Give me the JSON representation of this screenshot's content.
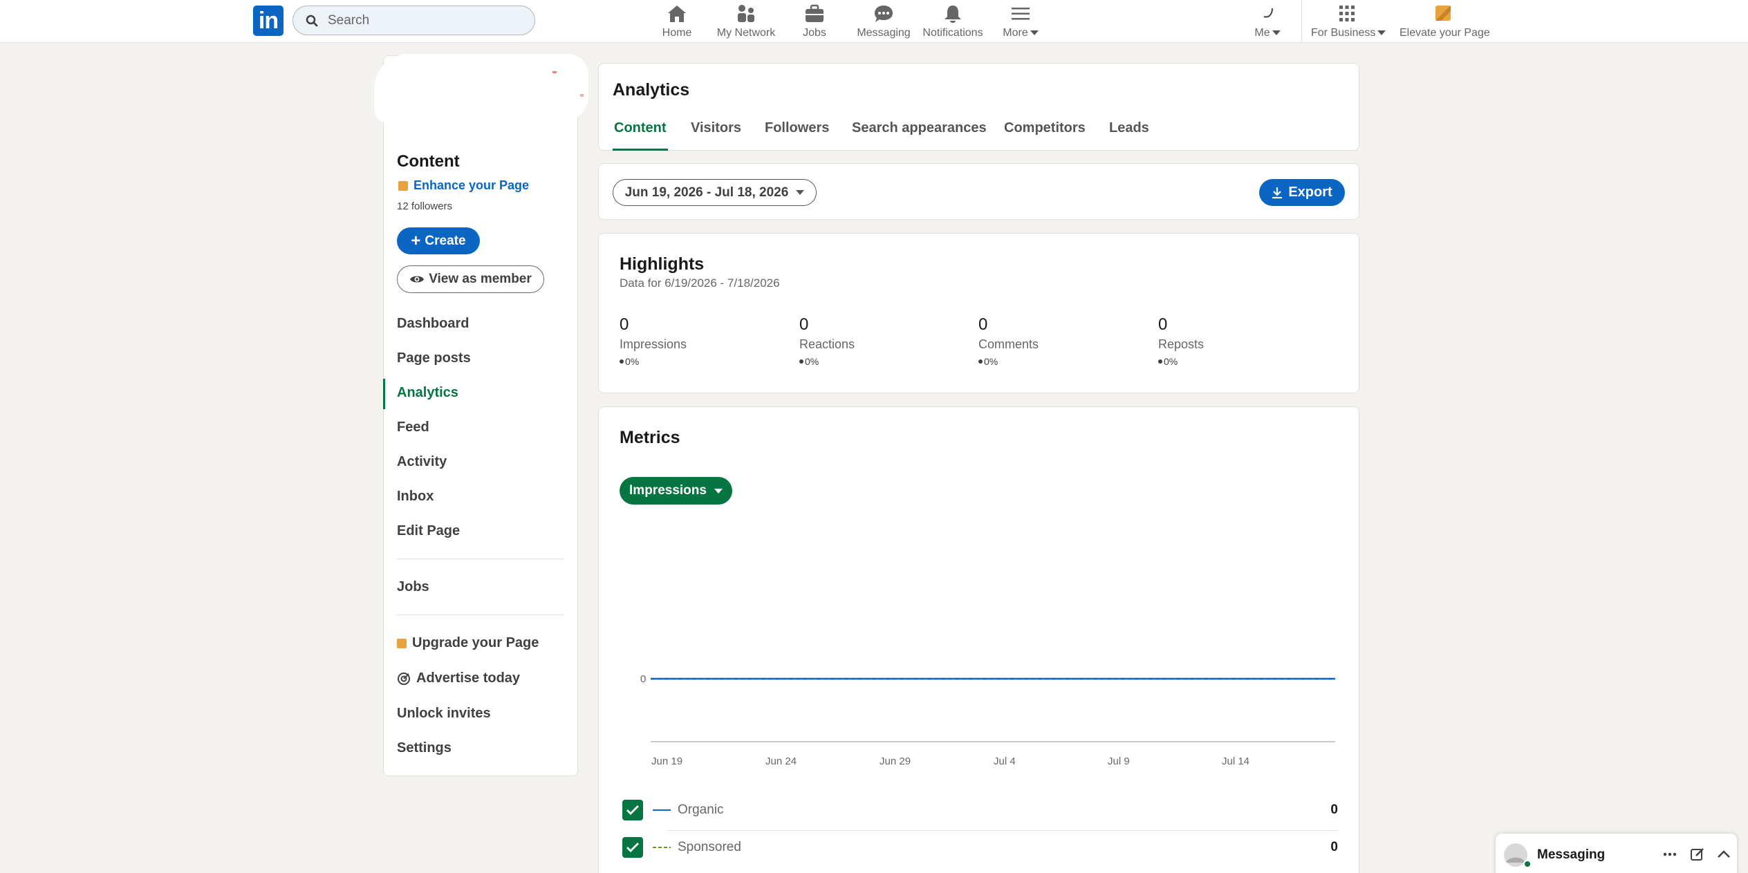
{
  "nav": {
    "logo": "in",
    "search_placeholder": "Search",
    "items": [
      {
        "label": "Home",
        "icon": "home-icon"
      },
      {
        "label": "My Network",
        "icon": "network-icon"
      },
      {
        "label": "Jobs",
        "icon": "briefcase-icon"
      },
      {
        "label": "Messaging",
        "icon": "messaging-icon"
      },
      {
        "label": "Notifications",
        "icon": "bell-icon"
      },
      {
        "label": "More",
        "icon": "menu-icon"
      }
    ],
    "me_label": "Me",
    "business_label": "For Business",
    "elevate_label": "Elevate your Page"
  },
  "sidebar": {
    "page_name": "Content",
    "enhance_label": "Enhance your Page",
    "followers": "12 followers",
    "create_label": "Create",
    "view_label": "View as member",
    "items": [
      "Dashboard",
      "Page posts",
      "Analytics",
      "Feed",
      "Activity",
      "Inbox",
      "Edit Page",
      "Jobs",
      "Upgrade your Page",
      "Advertise today",
      "Unlock invites",
      "Settings"
    ],
    "active_item": "Analytics"
  },
  "analytics": {
    "title": "Analytics",
    "tabs": [
      "Content",
      "Visitors",
      "Followers",
      "Search appearances",
      "Competitors",
      "Leads"
    ],
    "active_tab": "Content"
  },
  "range": {
    "label": "Jun 19, 2026 - Jul 18, 2026",
    "export_label": "Export"
  },
  "highlights": {
    "title": "Highlights",
    "subtitle": "Data for 6/19/2026 - 7/18/2026",
    "stats": [
      {
        "value": "0",
        "label": "Impressions",
        "change": "0%"
      },
      {
        "value": "0",
        "label": "Reactions",
        "change": "0%"
      },
      {
        "value": "0",
        "label": "Comments",
        "change": "0%"
      },
      {
        "value": "0",
        "label": "Reposts",
        "change": "0%"
      }
    ]
  },
  "metrics": {
    "title": "Metrics",
    "selector_label": "Impressions",
    "legend": [
      {
        "name": "Organic",
        "value": "0",
        "color": "#0a66c2",
        "checked": true
      },
      {
        "name": "Sponsored",
        "value": "0",
        "color": "#6b8e23",
        "checked": true
      }
    ]
  },
  "chart_data": {
    "type": "line",
    "x": [
      "Jun 19",
      "Jun 24",
      "Jun 29",
      "Jul 4",
      "Jul 9",
      "Jul 14"
    ],
    "series": [
      {
        "name": "Organic",
        "values": [
          0,
          0,
          0,
          0,
          0,
          0
        ]
      },
      {
        "name": "Sponsored",
        "values": [
          0,
          0,
          0,
          0,
          0,
          0
        ]
      }
    ],
    "y_ticks": [
      "0"
    ],
    "grid": false
  },
  "messaging": {
    "label": "Messaging"
  },
  "colors": {
    "brand_blue": "#0a66c2",
    "active_green": "#057642",
    "page_bg": "#f4f2ee"
  }
}
